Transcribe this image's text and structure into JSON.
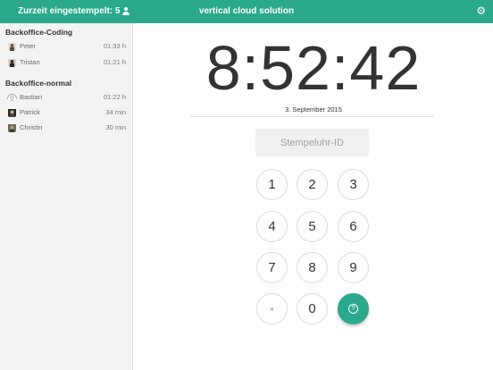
{
  "header": {
    "clocked_in_label": "Zurzeit eingestempelt: 5",
    "title": "vertical cloud solution",
    "settings_icon": "gear-icon"
  },
  "sidebar": {
    "groups": [
      {
        "title": "Backoffice-Coding",
        "employees": [
          {
            "name": "Peter",
            "time": "01:33 h"
          },
          {
            "name": "Tristan",
            "time": "01:21 h"
          }
        ]
      },
      {
        "title": "Backoffice-normal",
        "employees": [
          {
            "name": "Bastian",
            "time": "01:22 h"
          },
          {
            "name": "Patrick",
            "time": "34 min"
          },
          {
            "name": "Christin",
            "time": "30 min"
          }
        ]
      }
    ]
  },
  "main": {
    "clock": "8:52:42",
    "date": "3. September 2015",
    "id_placeholder": "Stempeluhr-ID",
    "keys": [
      "1",
      "2",
      "3",
      "4",
      "5",
      "6",
      "7",
      "8",
      "9",
      "×",
      "0"
    ],
    "go_icon": "help-circle-icon"
  },
  "colors": {
    "accent": "#2aa98c",
    "sidebar_bg": "#f3f3f3"
  }
}
